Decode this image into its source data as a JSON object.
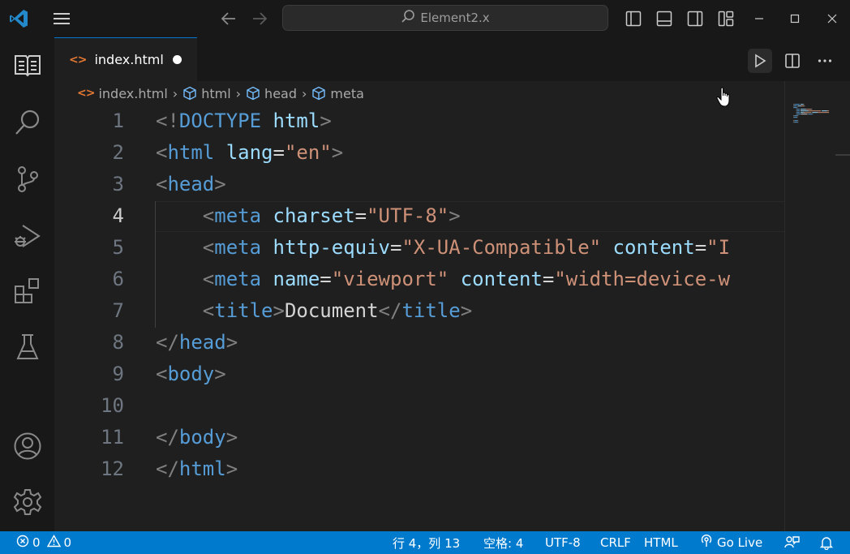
{
  "window": {
    "title": "Element2.x",
    "icons": [
      "vscode-logo",
      "menu-icon",
      "arrow-left-icon",
      "arrow-right-icon",
      "search-icon",
      "layout-sidebar-left-icon",
      "layout-panel-icon",
      "layout-sidebar-right-icon",
      "layout-customize-icon",
      "minimize-icon",
      "maximize-icon",
      "close-icon"
    ]
  },
  "activity_bar": {
    "items": [
      "explorer-icon",
      "search-icon",
      "source-control-icon",
      "run-debug-icon",
      "extensions-icon",
      "testing-icon",
      "accounts-icon",
      "settings-gear-icon"
    ]
  },
  "tabs": [
    {
      "label": "index.html",
      "dirty": true
    }
  ],
  "tab_actions": [
    "run-icon",
    "split-editor-icon",
    "more-actions-icon"
  ],
  "breadcrumb": [
    "index.html",
    "html",
    "head",
    "meta"
  ],
  "editor": {
    "active_line": 4,
    "lines": [
      {
        "n": "1",
        "tokens": [
          [
            "p",
            "<!"
          ],
          [
            "t",
            "DOCTYPE"
          ],
          [
            "x",
            " "
          ],
          [
            "a",
            "html"
          ],
          [
            "p",
            ">"
          ]
        ]
      },
      {
        "n": "2",
        "tokens": [
          [
            "p",
            "<"
          ],
          [
            "t",
            "html"
          ],
          [
            "x",
            " "
          ],
          [
            "a",
            "lang"
          ],
          [
            "x",
            "="
          ],
          [
            "s",
            "\"en\""
          ],
          [
            "p",
            ">"
          ]
        ]
      },
      {
        "n": "3",
        "tokens": [
          [
            "p",
            "<"
          ],
          [
            "t",
            "head"
          ],
          [
            "p",
            ">"
          ]
        ]
      },
      {
        "n": "4",
        "tokens": [
          [
            "x",
            "    "
          ],
          [
            "p",
            "<"
          ],
          [
            "t",
            "meta"
          ],
          [
            "x",
            " "
          ],
          [
            "a",
            "charset"
          ],
          [
            "x",
            "="
          ],
          [
            "s",
            "\"UTF-8\""
          ],
          [
            "p",
            ">"
          ]
        ]
      },
      {
        "n": "5",
        "tokens": [
          [
            "x",
            "    "
          ],
          [
            "p",
            "<"
          ],
          [
            "t",
            "meta"
          ],
          [
            "x",
            " "
          ],
          [
            "a",
            "http-equiv"
          ],
          [
            "x",
            "="
          ],
          [
            "s",
            "\"X-UA-Compatible\""
          ],
          [
            "x",
            " "
          ],
          [
            "a",
            "content"
          ],
          [
            "x",
            "="
          ],
          [
            "s",
            "\"I"
          ]
        ]
      },
      {
        "n": "6",
        "tokens": [
          [
            "x",
            "    "
          ],
          [
            "p",
            "<"
          ],
          [
            "t",
            "meta"
          ],
          [
            "x",
            " "
          ],
          [
            "a",
            "name"
          ],
          [
            "x",
            "="
          ],
          [
            "s",
            "\"viewport\""
          ],
          [
            "x",
            " "
          ],
          [
            "a",
            "content"
          ],
          [
            "x",
            "="
          ],
          [
            "s",
            "\"width=device-w"
          ]
        ]
      },
      {
        "n": "7",
        "tokens": [
          [
            "x",
            "    "
          ],
          [
            "p",
            "<"
          ],
          [
            "t",
            "title"
          ],
          [
            "p",
            ">"
          ],
          [
            "x",
            "Document"
          ],
          [
            "p",
            "</"
          ],
          [
            "t",
            "title"
          ],
          [
            "p",
            ">"
          ]
        ]
      },
      {
        "n": "8",
        "tokens": [
          [
            "p",
            "</"
          ],
          [
            "t",
            "head"
          ],
          [
            "p",
            ">"
          ]
        ]
      },
      {
        "n": "9",
        "tokens": [
          [
            "p",
            "<"
          ],
          [
            "t",
            "body"
          ],
          [
            "p",
            ">"
          ]
        ]
      },
      {
        "n": "10",
        "tokens": []
      },
      {
        "n": "11",
        "tokens": [
          [
            "p",
            "</"
          ],
          [
            "t",
            "body"
          ],
          [
            "p",
            ">"
          ]
        ]
      },
      {
        "n": "12",
        "tokens": [
          [
            "p",
            "</"
          ],
          [
            "t",
            "html"
          ],
          [
            "p",
            ">"
          ]
        ]
      }
    ]
  },
  "status_bar": {
    "errors": "0",
    "warnings": "0",
    "cursor_position": "行 4，列 13",
    "indentation": "空格: 4",
    "encoding": "UTF-8",
    "eol": "CRLF",
    "language": "HTML",
    "go_live": "Go Live"
  },
  "colors": {
    "accent": "#0078d4",
    "status_bar": "#007acc",
    "tag": "#569cd6",
    "attribute": "#9cdcfe",
    "string": "#ce9178",
    "html_file_icon": "#e37933"
  }
}
